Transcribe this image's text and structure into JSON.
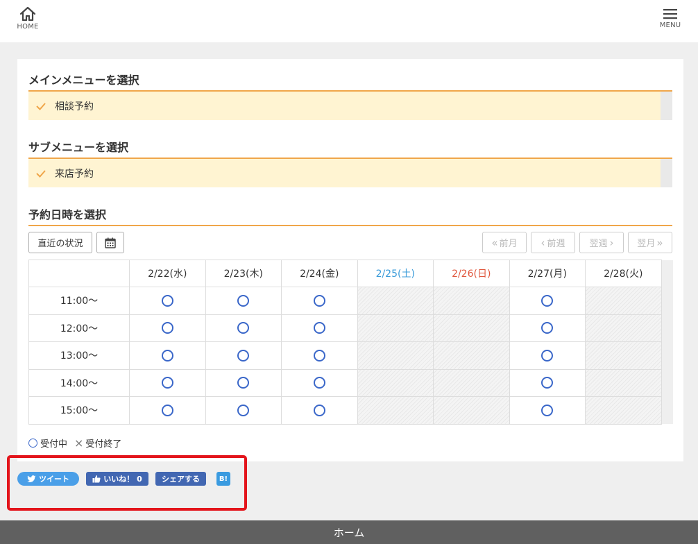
{
  "header": {
    "home_label": "HOME",
    "menu_label": "MENU"
  },
  "sections": {
    "main_menu": {
      "title": "メインメニューを選択",
      "selected": "相談予約"
    },
    "sub_menu": {
      "title": "サブメニューを選択",
      "selected": "来店予約"
    },
    "datetime": {
      "title": "予約日時を選択"
    }
  },
  "toolbar": {
    "recent_label": "直近の状況",
    "prev_month_label": "前月",
    "prev_week_label": "前週",
    "next_week_label": "翌週",
    "next_month_label": "翌月"
  },
  "schedule": {
    "days": [
      {
        "label": "2/22(水)",
        "type": "weekday"
      },
      {
        "label": "2/23(木)",
        "type": "weekday"
      },
      {
        "label": "2/24(金)",
        "type": "weekday"
      },
      {
        "label": "2/25(土)",
        "type": "saturday"
      },
      {
        "label": "2/26(日)",
        "type": "sunday"
      },
      {
        "label": "2/27(月)",
        "type": "weekday"
      },
      {
        "label": "2/28(火)",
        "type": "weekday"
      }
    ],
    "rows": [
      {
        "time": "11:00～",
        "slots": [
          "open",
          "open",
          "open",
          "closed",
          "closed",
          "open",
          "closed"
        ]
      },
      {
        "time": "12:00～",
        "slots": [
          "open",
          "open",
          "open",
          "closed",
          "closed",
          "open",
          "closed"
        ]
      },
      {
        "time": "13:00～",
        "slots": [
          "open",
          "open",
          "open",
          "closed",
          "closed",
          "open",
          "closed"
        ]
      },
      {
        "time": "14:00～",
        "slots": [
          "open",
          "open",
          "open",
          "closed",
          "closed",
          "open",
          "closed"
        ]
      },
      {
        "time": "15:00～",
        "slots": [
          "open",
          "open",
          "open",
          "closed",
          "closed",
          "open",
          "closed"
        ]
      }
    ]
  },
  "legend": {
    "open_label": "受付中",
    "closed_label": "受付終了"
  },
  "share": {
    "tweet_label": "ツイート",
    "like_label": "いいね！ 0",
    "share_label": "シェアする",
    "hatena_label": "B!"
  },
  "footer": {
    "label": "ホーム"
  },
  "colors": {
    "accent_orange": "#f0a64a",
    "selected_bg": "#fff4d2",
    "open_circle": "#3a67c9",
    "saturday": "#3a9bd9",
    "sunday": "#e0573d",
    "highlight_border": "#e3141b"
  }
}
